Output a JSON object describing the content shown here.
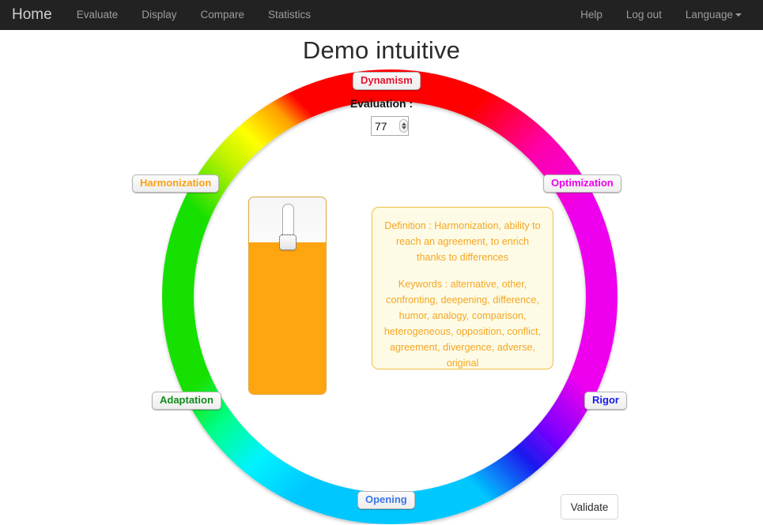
{
  "navbar": {
    "brand": "Home",
    "left_items": [
      {
        "label": "Evaluate"
      },
      {
        "label": "Display"
      },
      {
        "label": "Compare"
      },
      {
        "label": "Statistics"
      }
    ],
    "right_items": [
      {
        "label": "Help"
      },
      {
        "label": "Log out"
      },
      {
        "label": "Language"
      }
    ],
    "background_color": "#222222",
    "text_color": "#9d9d9d"
  },
  "page": {
    "title": "Demo intuitive"
  },
  "wheel": {
    "labels": [
      {
        "name": "dynamism",
        "label": "Dynamism",
        "color": "#e8112d"
      },
      {
        "name": "optimization",
        "label": "Optimization",
        "color": "#ee00ee"
      },
      {
        "name": "rigor",
        "label": "Rigor",
        "color": "#1a1aee"
      },
      {
        "name": "opening",
        "label": "Opening",
        "color": "#3b76e8"
      },
      {
        "name": "adaptation",
        "label": "Adaptation",
        "color": "#108b1b"
      },
      {
        "name": "harmonization",
        "label": "Harmonization",
        "color": "#f7a117"
      }
    ],
    "gradient_stops": [
      "#ff0000",
      "#ff00aa",
      "#ee00ee",
      "#8800ff",
      "#1a1aee",
      "#0088ff",
      "#00e5ff",
      "#00ff99",
      "#00e000",
      "#88e000",
      "#ffff00",
      "#ffa500",
      "#ff0000"
    ]
  },
  "evaluation": {
    "label": "Evaluation :",
    "value": "77",
    "min": "0",
    "max": "100"
  },
  "slider": {
    "value": 77,
    "fill_color": "#ffa510",
    "orientation": "vertical"
  },
  "definition": {
    "definition_text": "Definition : Harmonization, ability to reach an agreement, to enrich thanks to differences",
    "keywords_text": "Keywords : alternative, other, confronting, deepening, difference, humor, analogy, comparison, heterogeneous, opposition, conflict, agreement, divergence, adverse, original",
    "text_color": "#f5a623",
    "background_color": "#fdfbe6"
  },
  "actions": {
    "validate_label": "Validate"
  }
}
